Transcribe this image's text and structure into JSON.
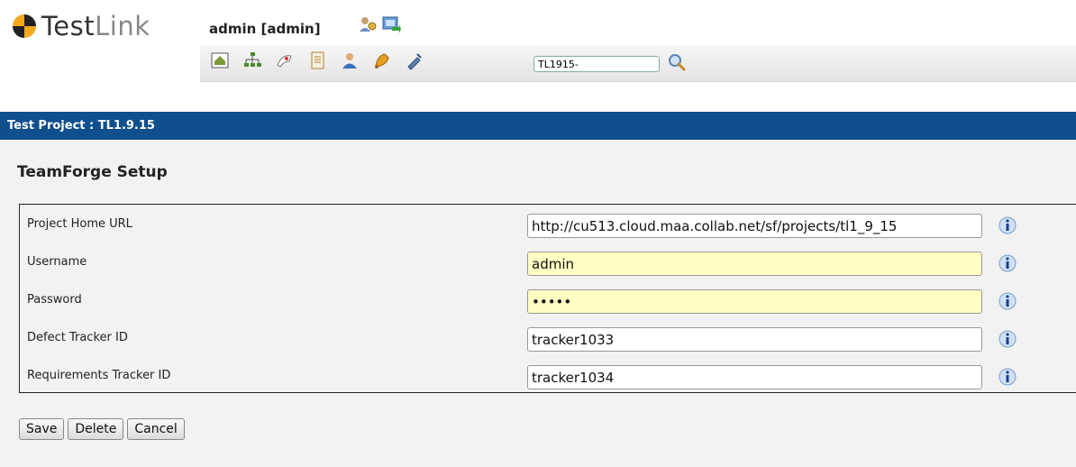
{
  "header": {
    "logo_text_a": "Test",
    "logo_text_b": "Link",
    "user": "admin [admin]",
    "search_value": "TL1915-",
    "toolbar_icons": [
      "home-icon",
      "sitemap-icon",
      "specification-icon",
      "document-icon",
      "user-icon",
      "bell-icon",
      "plugin-icon"
    ]
  },
  "project_bar": {
    "label": "Test Project : TL1.9.15"
  },
  "page": {
    "title": "TeamForge Setup"
  },
  "form": {
    "rows": [
      {
        "label": "Project Home URL",
        "value": "http://cu513.cloud.maa.collab.net/sf/projects/tl1_9_15",
        "highlight": false
      },
      {
        "label": "Username",
        "value": "admin",
        "highlight": true
      },
      {
        "label": "Password",
        "value": "•••••",
        "highlight": true
      },
      {
        "label": "Defect Tracker ID",
        "value": "tracker1033",
        "highlight": false
      },
      {
        "label": "Requirements Tracker ID",
        "value": "tracker1034",
        "highlight": false
      }
    ]
  },
  "actions": {
    "save": "Save",
    "delete": "Delete",
    "cancel": "Cancel"
  },
  "colors": {
    "project_bar": "#0f4f8e",
    "highlight_field": "#ffffc4"
  }
}
